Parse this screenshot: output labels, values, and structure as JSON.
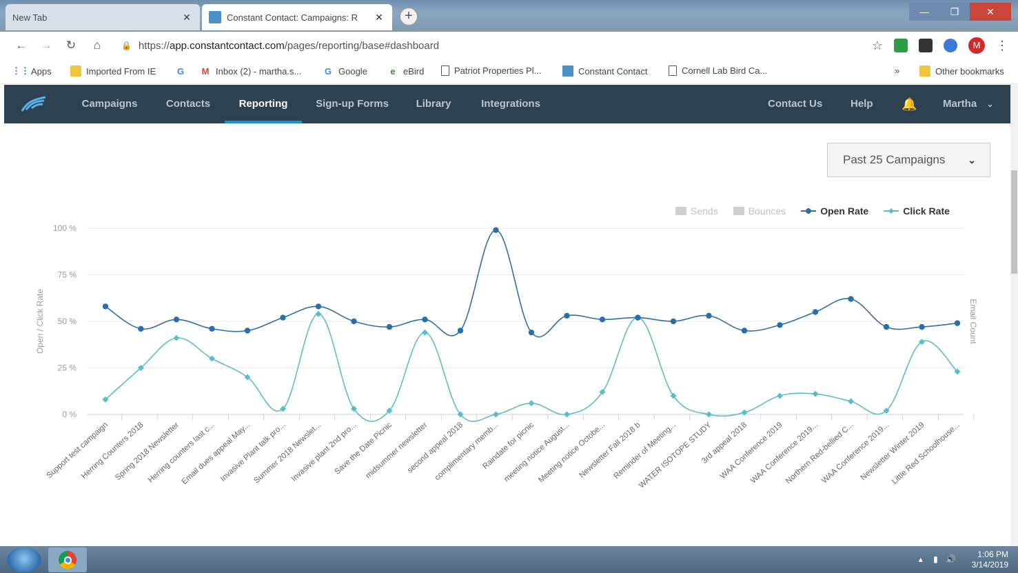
{
  "browser": {
    "tabs": [
      {
        "label": "New Tab",
        "active": false
      },
      {
        "label": "Constant Contact: Campaigns: R",
        "active": true
      }
    ],
    "url_scheme": "https://",
    "url_host": "app.constantcontact.com",
    "url_path": "/pages/reporting/base#dashboard",
    "profile_initial": "M",
    "bookmarks": [
      {
        "label": "Apps",
        "icon": "apps-grid-icon"
      },
      {
        "label": "Imported From IE",
        "icon": "folder-icon"
      },
      {
        "label": "",
        "icon": "google-g-icon"
      },
      {
        "label": "Inbox (2) - martha.s...",
        "icon": "gmail-icon"
      },
      {
        "label": "Google",
        "icon": "google-g-icon"
      },
      {
        "label": "eBird",
        "icon": "ebird-icon"
      },
      {
        "label": "Patriot Properties Pl...",
        "icon": "page-icon"
      },
      {
        "label": "Constant Contact",
        "icon": "constant-contact-icon"
      },
      {
        "label": "Cornell Lab Bird Ca...",
        "icon": "page-icon"
      }
    ],
    "overflow_label": "»",
    "other_bookmarks": "Other bookmarks"
  },
  "appnav": {
    "items": [
      {
        "label": "Campaigns",
        "active": false
      },
      {
        "label": "Contacts",
        "active": false
      },
      {
        "label": "Reporting",
        "active": true
      },
      {
        "label": "Sign-up Forms",
        "active": false
      },
      {
        "label": "Library",
        "active": false
      },
      {
        "label": "Integrations",
        "active": false
      }
    ],
    "contact_us": "Contact Us",
    "help": "Help",
    "user": "Martha"
  },
  "filter": {
    "selected": "Past 25 Campaigns"
  },
  "taskbar": {
    "time": "1:06 PM",
    "date": "3/14/2019"
  },
  "colors": {
    "open_rate": "#2a6fad",
    "click_rate": "#5bbccc",
    "nav_bg": "#2d4150",
    "nav_active": "#1e8fcf"
  },
  "chart_data": {
    "type": "line",
    "ylabel": "Open / Click Rate",
    "y2label": "Email Count",
    "ylim": [
      0,
      100
    ],
    "yticks": [
      "0 %",
      "25 %",
      "50 %",
      "75 %",
      "100 %"
    ],
    "legend": [
      {
        "name": "Sends",
        "enabled": false
      },
      {
        "name": "Bounces",
        "enabled": false
      },
      {
        "name": "Open Rate",
        "enabled": true
      },
      {
        "name": "Click Rate",
        "enabled": true
      }
    ],
    "legend_position": "top-right",
    "categories": [
      "Support test campaign",
      "Herring Counters 2018",
      "Spring 2018 Newsletter",
      "Herring counters last c...",
      "Email dues appeal May...",
      "Invasive Plant talk pro...",
      "Summer 2018 Newslet...",
      "Invasive plant 2nd pro...",
      "Save the Date Picnic",
      "midsummer newsletter",
      "second appeal 2018",
      "complimentary memb...",
      "Raindate for picnic",
      "meeting notice August...",
      "Meeting notice Octobe...",
      "Newsletter Fall 2018 b",
      "Reminder of Meeting...",
      "WATER ISOTOPE STUDY",
      "3rd appeal 2018",
      "WAA Conference 2019",
      "WAA Conference 2019...",
      "Northern Red-bellied C...",
      "WAA Conference 2019...",
      "Newsletter Winter 2019",
      "Little Red Schoolhouse..."
    ],
    "series": [
      {
        "name": "Open Rate",
        "values": [
          58,
          46,
          51,
          46,
          45,
          52,
          58,
          50,
          47,
          51,
          45,
          99,
          44,
          53,
          51,
          52,
          50,
          53,
          45,
          48,
          55,
          62,
          47,
          47,
          49
        ]
      },
      {
        "name": "Click Rate",
        "values": [
          8,
          25,
          41,
          30,
          20,
          3,
          54,
          3,
          2,
          44,
          0,
          0,
          6,
          0,
          12,
          52,
          10,
          0,
          1,
          10,
          11,
          7,
          2,
          39,
          23
        ]
      }
    ]
  }
}
